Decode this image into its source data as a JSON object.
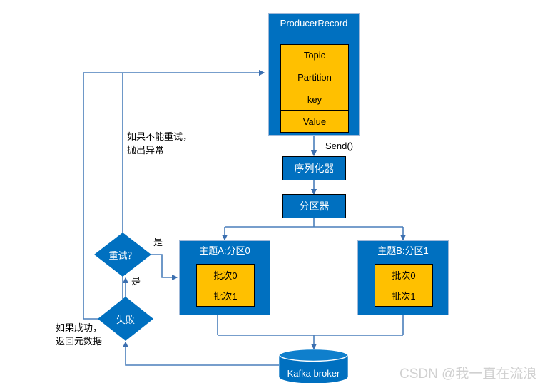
{
  "diagram": {
    "title_watermark": "CSDN @我一直在流浪",
    "producer_record": {
      "title": "ProducerRecord",
      "fields": [
        {
          "label": "Topic"
        },
        {
          "label": "Partition"
        },
        {
          "label": "key"
        },
        {
          "label": "Value"
        }
      ]
    },
    "steps": {
      "serializer": "序列化器",
      "partitioner": "分区器"
    },
    "topics": [
      {
        "title": "主题A:分区0",
        "batches": [
          {
            "label": "批次0"
          },
          {
            "label": "批次1"
          }
        ]
      },
      {
        "title": "主题B:分区1",
        "batches": [
          {
            "label": "批次0"
          },
          {
            "label": "批次1"
          }
        ]
      }
    ],
    "decisions": {
      "retry": "重试？",
      "failure": "失败"
    },
    "broker": {
      "label": "Kafka broker"
    },
    "edge_labels": {
      "send": "Send()",
      "retry_yes_right": "是",
      "retry_yes_bottom": "是"
    },
    "annotations": {
      "throw_exception": "如果不能重试，\n抛出异常",
      "return_metadata": "如果成功，\n返回元数据"
    },
    "colors": {
      "blue": "#0070C0",
      "orange": "#FFC000",
      "wire": "#4a7ebb",
      "watermark": "#d0d0d0"
    }
  }
}
